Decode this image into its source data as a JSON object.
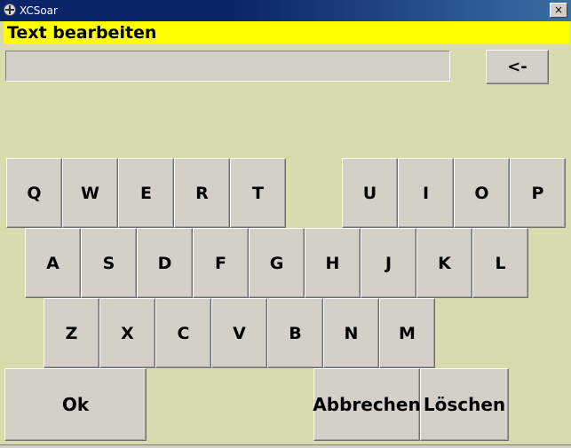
{
  "window": {
    "title": "XCSoar",
    "close_glyph": "×"
  },
  "dialog": {
    "caption": "Text bearbeiten"
  },
  "text_field": {
    "value": ""
  },
  "backspace_label": "<-",
  "keyboard": {
    "row1a": [
      "Q",
      "W",
      "E",
      "R",
      "T"
    ],
    "row1b": [
      "U",
      "I",
      "O",
      "P"
    ],
    "row2": [
      "A",
      "S",
      "D",
      "F",
      "G",
      "H",
      "J",
      "K",
      "L"
    ],
    "row3": [
      "Z",
      "X",
      "C",
      "V",
      "B",
      "N",
      "M"
    ]
  },
  "buttons": {
    "ok": "Ok",
    "cancel": "Abbrechen",
    "clear": "Löschen"
  },
  "colors": {
    "background": "#d9dbac",
    "caption_bg": "#ffff00",
    "titlebar": "#0a246a",
    "button_face": "#d4d0c8"
  },
  "icons": {
    "app": "xcsoar-app-icon",
    "close": "close-icon"
  }
}
